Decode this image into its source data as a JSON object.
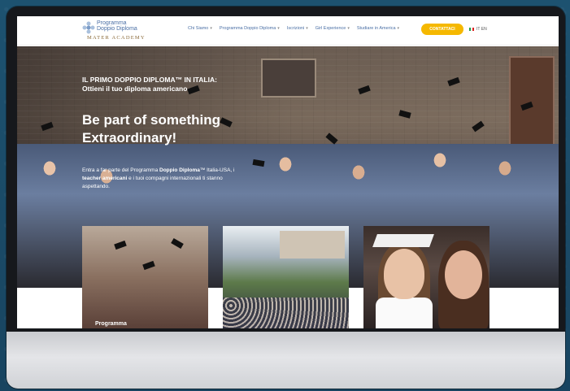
{
  "colors": {
    "accent": "#f5b800",
    "nav_text": "#4a6fa5",
    "backdrop": "#1b4a63"
  },
  "logo": {
    "line1": "Programma",
    "line2": "Doppio Diploma",
    "line3": "MATER ACADEMY",
    "icon": "flower-logo-icon"
  },
  "nav": {
    "items": [
      {
        "label": "Chi Siamo"
      },
      {
        "label": "Programma Doppio Diploma"
      },
      {
        "label": "Iscrizioni"
      },
      {
        "label": "Girl Experience"
      },
      {
        "label": "Studiare in America"
      }
    ],
    "cta_label": "CONTATTACI",
    "lang": "IT  EN"
  },
  "hero": {
    "eyebrow": "IL PRIMO DOPPIO DIPLOMA™ IN ITALIA:",
    "eyebrow_sub": "Ottieni il tuo diploma americano",
    "headline_line1": "Be part of something",
    "headline_line2": "Extraordinary!",
    "body_pre": "Entra a far parte del Programma ",
    "body_bold1": "Doppio Diploma",
    "body_mid": "™ Italia-USA, i ",
    "body_bold2": "teacher americani",
    "body_post": " e i tuoi compagni internazionali ti stanno aspettando."
  },
  "cards": [
    {
      "label": "Programma"
    },
    {
      "label": ""
    },
    {
      "label": ""
    }
  ]
}
